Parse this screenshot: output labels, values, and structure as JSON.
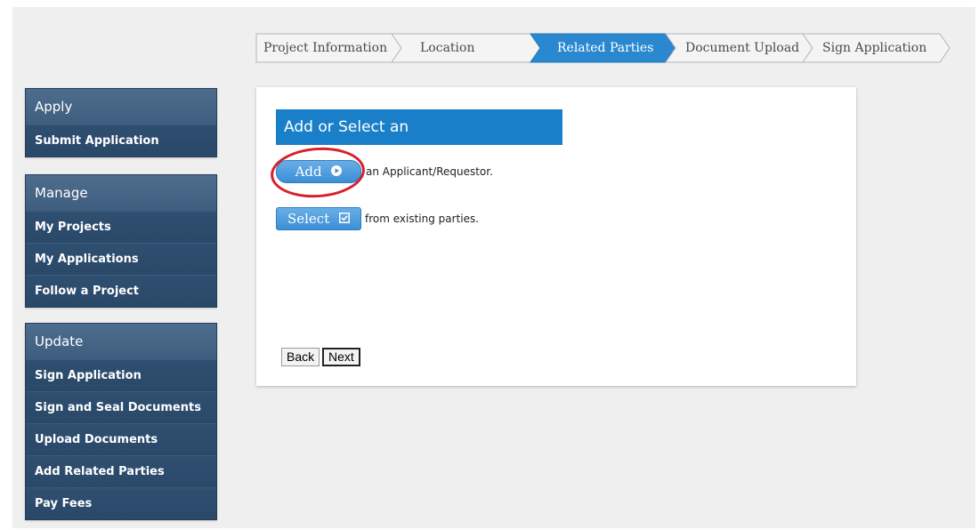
{
  "wizard": {
    "steps": [
      {
        "label": "Project Information",
        "active": false
      },
      {
        "label": "Location",
        "active": false
      },
      {
        "label": "Related Parties",
        "active": true
      },
      {
        "label": "Document Upload",
        "active": false
      },
      {
        "label": "Sign Application",
        "active": false
      }
    ]
  },
  "sidebar": {
    "apply": {
      "title": "Apply",
      "items": [
        "Submit Application"
      ]
    },
    "manage": {
      "title": "Manage",
      "items": [
        "My Projects",
        "My Applications",
        "Follow a Project"
      ]
    },
    "update": {
      "title": "Update",
      "items": [
        "Sign Application",
        "Sign and Seal Documents",
        "Upload Documents",
        "Add Related Parties",
        "Pay Fees"
      ]
    }
  },
  "main": {
    "section_title": "Add or Select an Applicant/Requestor",
    "add_button": "Add",
    "add_icon": "play-circle-icon",
    "add_helper": "an Applicant/Requestor.",
    "select_button": "Select",
    "select_icon": "checkbox-icon",
    "select_helper": "from existing parties.",
    "back_button": "Back",
    "next_button": "Next"
  },
  "colors": {
    "active_step": "#2a88d0",
    "sidebar_header": "#4a6a8a",
    "sidebar_item": "#2b4a6a",
    "section_title_bg": "#1a7fc9",
    "highlight_ring": "#d8202a"
  }
}
